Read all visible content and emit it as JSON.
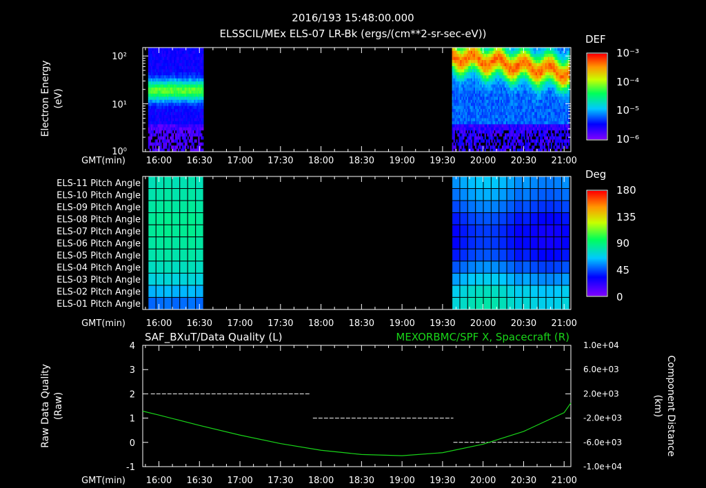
{
  "header": {
    "timestamp": "2016/193 15:48:00.000",
    "title": "ELSSCIL/MEx ELS-07 LR-Bk  (ergs/(cm**2-sr-sec-eV))"
  },
  "panel1": {
    "ylabel_line1": "Electron Energy",
    "ylabel_line2": "(eV)",
    "yticks": [
      "10²",
      "10¹",
      "10⁰"
    ],
    "colorbar": {
      "label": "DEF",
      "ticks": [
        "10⁻³",
        "10⁻⁴",
        "10⁻⁵",
        "10⁻⁶"
      ]
    }
  },
  "panel2": {
    "rows": [
      "ELS-11 Pitch Angle",
      "ELS-10 Pitch Angle",
      "ELS-09 Pitch Angle",
      "ELS-08 Pitch Angle",
      "ELS-07 Pitch Angle",
      "ELS-06 Pitch Angle",
      "ELS-05 Pitch Angle",
      "ELS-04 Pitch Angle",
      "ELS-03 Pitch Angle",
      "ELS-02 Pitch Angle",
      "ELS-01 Pitch Angle"
    ],
    "colorbar": {
      "label": "Deg",
      "ticks": [
        "180",
        "135",
        "90",
        "45",
        "0"
      ]
    }
  },
  "panel3": {
    "left_title": "SAF_BXuT/Data Quality (L)",
    "right_title": "MEXORBMC/SPF X, Spacecraft (R)",
    "ylabel_left_line1": "Raw Data Quality",
    "ylabel_left_line2": "(Raw)",
    "ylabel_right_line1": "Component Distance",
    "ylabel_right_line2": "(km)",
    "left_ticks": [
      "4",
      "3",
      "2",
      "1",
      "0",
      "-1"
    ],
    "right_ticks": [
      "1.0e+04",
      "6.0e+03",
      "2.0e+03",
      "-2.0e+03",
      "-6.0e+03",
      "-1.0e+04"
    ]
  },
  "time_axis": {
    "label": "GMT(min)",
    "ticks": [
      "16:00",
      "16:30",
      "17:00",
      "17:30",
      "18:00",
      "18:30",
      "19:00",
      "19:30",
      "20:00",
      "20:30",
      "21:00"
    ]
  },
  "colors": {
    "trajectory": "#19d619",
    "quality": "#ffffff",
    "frame": "#ffffff"
  },
  "chart_data": [
    {
      "type": "heatmap",
      "title": "ELSSCIL/MEx ELS-07 LR-Bk  (ergs/(cm**2-sr-sec-eV))",
      "xlabel": "GMT(min)",
      "ylabel": "Electron Energy (eV)",
      "y_scale": "log",
      "ylim": [
        1,
        150
      ],
      "colorbar": {
        "label": "DEF",
        "scale": "log",
        "range": [
          1e-06,
          0.001
        ]
      },
      "data_intervals": [
        [
          "15:52",
          "16:33"
        ],
        [
          "19:37",
          "21:04"
        ]
      ]
    },
    {
      "type": "heatmap",
      "xlabel": "GMT(min)",
      "rows": [
        "ELS-11",
        "ELS-10",
        "ELS-09",
        "ELS-08",
        "ELS-07",
        "ELS-06",
        "ELS-05",
        "ELS-04",
        "ELS-03",
        "ELS-02",
        "ELS-01"
      ],
      "colorbar": {
        "label": "Deg",
        "range": [
          0,
          180
        ]
      },
      "segments": [
        {
          "start": "15:52",
          "end": "16:33",
          "pitch_angle_deg": [
            80,
            82,
            84,
            86,
            86,
            84,
            82,
            78,
            72,
            62,
            50
          ]
        },
        {
          "start": "19:37",
          "end": "21:04",
          "pitch_angle_deg": [
            60,
            55,
            48,
            40,
            36,
            36,
            40,
            50,
            62,
            72,
            76
          ]
        }
      ]
    },
    {
      "type": "line",
      "xlabel": "GMT(min)",
      "series": [
        {
          "name": "SAF_BXuT/Data Quality (L)",
          "axis": "left",
          "style": "dashed",
          "segments": [
            {
              "start": "15:54",
              "end": "17:52",
              "value": 2
            },
            {
              "start": "17:54",
              "end": "19:38",
              "value": 1
            },
            {
              "start": "19:38",
              "end": "21:00",
              "value": 0
            }
          ]
        },
        {
          "name": "MEXORBMC/SPF X, Spacecraft (R)",
          "axis": "right",
          "x": [
            "15:48",
            "16:00",
            "16:30",
            "17:00",
            "17:30",
            "18:00",
            "18:30",
            "19:00",
            "19:30",
            "20:00",
            "20:30",
            "21:00",
            "21:05"
          ],
          "values": [
            -850,
            -1500,
            -3200,
            -4800,
            -6200,
            -7300,
            -8000,
            -8200,
            -7700,
            -6300,
            -4200,
            -1100,
            500
          ]
        }
      ],
      "ylim_left": [
        -1,
        4
      ],
      "ylim_right": [
        -10000,
        10000
      ]
    }
  ]
}
